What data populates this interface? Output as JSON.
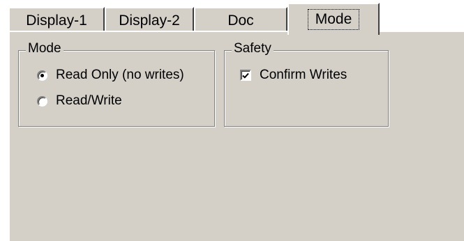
{
  "tabs": [
    {
      "label": "Display-1",
      "active": false
    },
    {
      "label": "Display-2",
      "active": false
    },
    {
      "label": "Doc",
      "active": false
    },
    {
      "label": "Mode",
      "active": true
    }
  ],
  "mode_group": {
    "title": "Mode",
    "options": [
      {
        "label": "Read Only (no writes)",
        "selected": true
      },
      {
        "label": "Read/Write",
        "selected": false
      }
    ]
  },
  "safety_group": {
    "title": "Safety",
    "checkbox": {
      "label": "Confirm Writes",
      "checked": true
    }
  },
  "colors": {
    "face": "#d4d0c8",
    "highlight": "#ffffff",
    "shadow": "#808080",
    "dark_shadow": "#404040"
  }
}
